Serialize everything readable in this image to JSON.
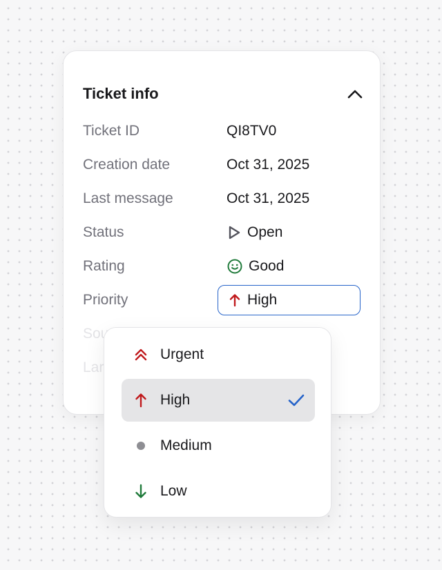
{
  "card": {
    "title": "Ticket info",
    "collapse_icon": "chevron-up-icon",
    "fields": [
      {
        "label": "Ticket ID",
        "value": "QI8TV0"
      },
      {
        "label": "Creation date",
        "value": "Oct 31, 2025"
      },
      {
        "label": "Last message",
        "value": "Oct 31, 2025"
      },
      {
        "label": "Status",
        "value": "Open",
        "icon": "play-outline-icon"
      },
      {
        "label": "Rating",
        "value": "Good",
        "icon": "smile-icon"
      },
      {
        "label": "Priority",
        "value": "High",
        "icon": "arrow-up-icon"
      },
      {
        "label": "Sou"
      },
      {
        "label": "Lar"
      }
    ]
  },
  "priority_dropdown": {
    "options": [
      {
        "label": "Urgent",
        "icon": "double-chevron-up-icon",
        "selected": false
      },
      {
        "label": "High",
        "icon": "arrow-up-icon",
        "selected": true
      },
      {
        "label": "Medium",
        "icon": "dot-icon",
        "selected": false
      },
      {
        "label": "Low",
        "icon": "arrow-down-icon",
        "selected": false
      }
    ],
    "selected_icon": "checkmark-icon"
  },
  "colors": {
    "urgent": "#c0191c",
    "high": "#c0191c",
    "medium": "#8e8e93",
    "low": "#1f7a3a",
    "rating_good": "#1f7a3a",
    "focus_border": "#2563c9",
    "check": "#2563c9"
  }
}
